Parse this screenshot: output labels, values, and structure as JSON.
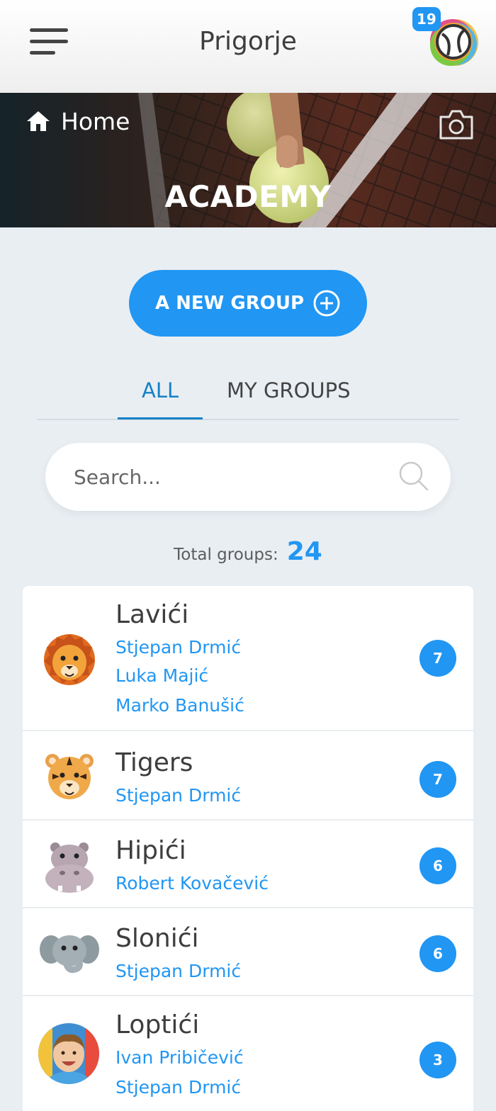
{
  "header": {
    "title": "Prigorje",
    "notification_count": "19",
    "menu_icon": "hamburger-menu-icon",
    "logo_icon": "tennis-ball-logo-icon"
  },
  "hero": {
    "home_label": "Home",
    "title": "ACADEMY",
    "home_icon": "home-icon",
    "camera_icon": "camera-icon"
  },
  "actions": {
    "new_group_label": "A NEW GROUP",
    "new_group_icon": "plus-circle-icon"
  },
  "tabs": [
    {
      "label": "ALL",
      "active": true
    },
    {
      "label": "MY GROUPS",
      "active": false
    }
  ],
  "search": {
    "placeholder": "Search...",
    "value": ""
  },
  "summary": {
    "total_label": "Total groups:",
    "total_value": "24"
  },
  "groups": [
    {
      "name": "Lavići",
      "coaches": [
        "Stjepan Drmić",
        "Luka Majić",
        "Marko Banušić"
      ],
      "members": "7",
      "avatar": "lion-icon"
    },
    {
      "name": "Tigers",
      "coaches": [
        "Stjepan Drmić"
      ],
      "members": "7",
      "avatar": "tiger-icon"
    },
    {
      "name": "Hipići",
      "coaches": [
        "Robert Kovačević"
      ],
      "members": "6",
      "avatar": "hippo-icon"
    },
    {
      "name": "Slonići",
      "coaches": [
        "Stjepan Drmić"
      ],
      "members": "6",
      "avatar": "elephant-icon"
    },
    {
      "name": "Loptići",
      "coaches": [
        "Ivan Pribičević",
        "Stjepan Drmić"
      ],
      "members": "3",
      "avatar": "child-photo"
    }
  ],
  "colors": {
    "accent": "#2196f3",
    "tab_active": "#1581c5",
    "background": "#e9eef3",
    "text": "#3d3d3d"
  }
}
